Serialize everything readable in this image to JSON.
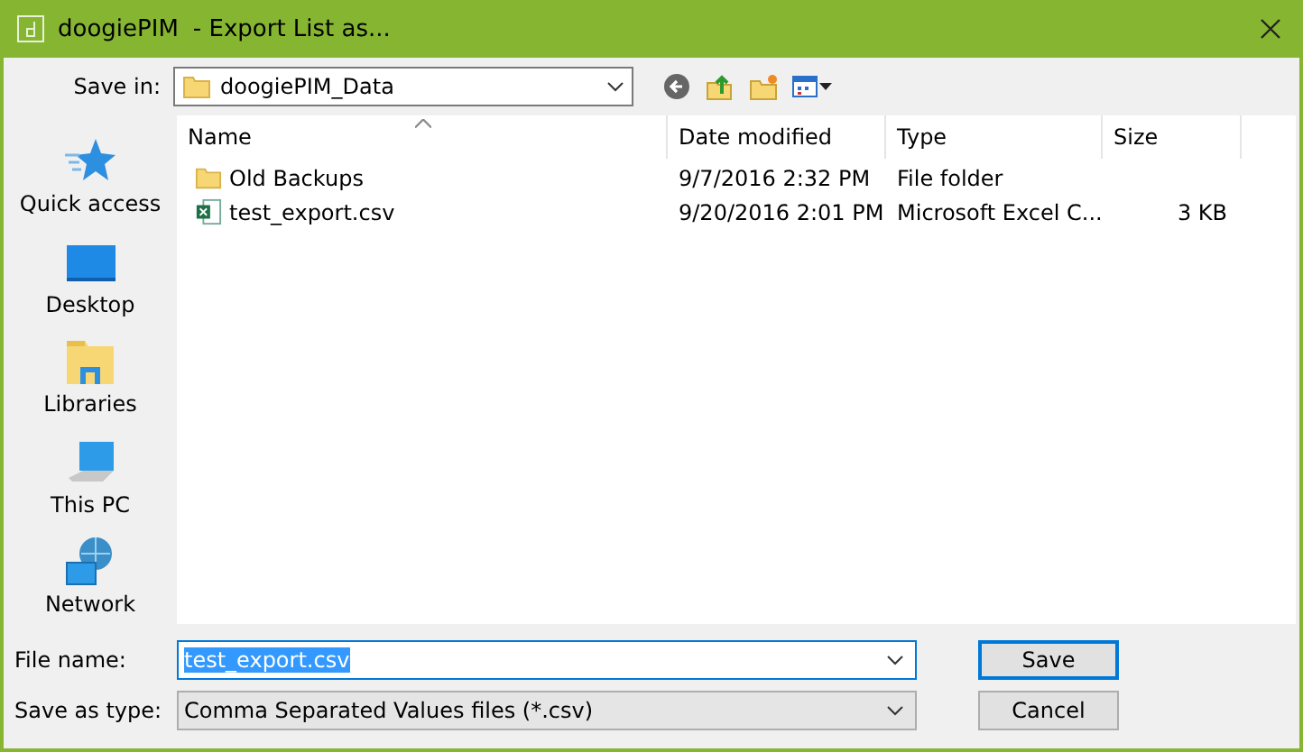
{
  "window": {
    "app": "doogiePIM",
    "title": "- Export List as..."
  },
  "save_in": {
    "label": "Save in:",
    "value": "doogiePIM_Data"
  },
  "places": [
    {
      "label": "Quick access",
      "kind": "star"
    },
    {
      "label": "Desktop",
      "kind": "desktop"
    },
    {
      "label": "Libraries",
      "kind": "libraries"
    },
    {
      "label": "This PC",
      "kind": "pc"
    },
    {
      "label": "Network",
      "kind": "network"
    }
  ],
  "table": {
    "columns": [
      "Name",
      "Date modified",
      "Type",
      "Size"
    ],
    "rows": [
      {
        "kind": "folder",
        "name": "Old Backups",
        "date": "9/7/2016 2:32 PM",
        "type": "File folder",
        "size": ""
      },
      {
        "kind": "csv",
        "name": "test_export.csv",
        "date": "9/20/2016 2:01 PM",
        "type": "Microsoft Excel C...",
        "size": "3 KB"
      }
    ]
  },
  "file_name": {
    "label": "File name:",
    "value": "test_export.csv",
    "selected": true
  },
  "save_type": {
    "label": "Save as type:",
    "value": "Comma Separated Values files (*.csv)"
  },
  "buttons": [
    {
      "label": "Save",
      "default": true
    },
    {
      "label": "Cancel",
      "default": false
    }
  ]
}
